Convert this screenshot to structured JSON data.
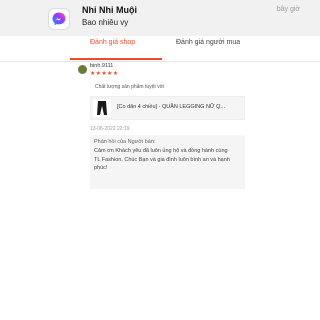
{
  "notification": {
    "sender": "Nhi Nhi Muội",
    "message": "Bao nhiêu vy",
    "time": "bây giờ",
    "icon": "messenger-icon"
  },
  "tabs": [
    {
      "label": "Đánh giá shop",
      "active": true
    },
    {
      "label": "Đánh giá người mua",
      "active": false
    }
  ],
  "review": {
    "username": "binh.9111",
    "rating": 5,
    "stars_text": "★★★★★",
    "quality_text": "Chất lượng sản phẩm tuyệt vời",
    "product_name": "[Co dãn 4 chiều] - QUẦN LEGGING NỮ Q...",
    "date": "13-06-2022 22:19",
    "reply_title": "Phản hồi của Người bán:",
    "reply_text": "Cảm ơn Khách yêu đã luôn ủng hộ và đồng hành cùng TL Fashion. Chúc Bạn và gia đình luôn bình an và hạnh phúc!"
  },
  "colors": {
    "accent": "#ee4d2d",
    "messenger_start": "#a334fa",
    "messenger_end": "#0695ff"
  }
}
